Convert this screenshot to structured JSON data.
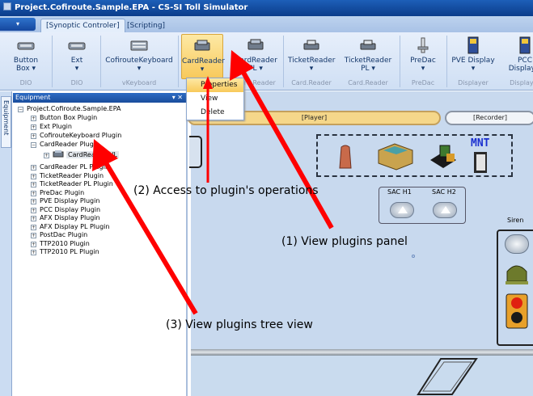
{
  "window": {
    "title": "Project.Cofiroute.Sample.EPA - CS-SI Toll Simulator"
  },
  "tabs": [
    {
      "label": "[Synoptic Controler]",
      "active": true
    },
    {
      "label": "[Scripting]",
      "active": false
    }
  ],
  "ribbon": {
    "buttons": [
      {
        "label": "Button Box",
        "group": "DIO",
        "icon": "device-icon"
      },
      {
        "label": "Ext",
        "group": "DIO",
        "icon": "device-icon"
      },
      {
        "label": "CofirouteKeyboard",
        "group": "vKeyboard",
        "icon": "keyboard-icon"
      },
      {
        "label": "CardReader",
        "group": "",
        "icon": "card-reader-icon",
        "selected": true
      },
      {
        "label": "CardReader PL",
        "group": "Card.Reader",
        "icon": "card-reader-icon"
      },
      {
        "label": "TicketReader",
        "group": "Card.Reader",
        "icon": "ticket-reader-icon"
      },
      {
        "label": "TicketReader PL",
        "group": "Card.Reader",
        "icon": "ticket-reader-icon"
      },
      {
        "label": "PreDac",
        "group": "PreDac",
        "icon": "predac-icon"
      },
      {
        "label": "PVE Display",
        "group": "Displayer",
        "icon": "display-icon"
      },
      {
        "label": "PCC Display",
        "group": "Displayer",
        "icon": "display-icon"
      }
    ],
    "dropdown": [
      "Properties",
      "View",
      "Delete"
    ]
  },
  "sidebar": {
    "tab_label": "Equipment"
  },
  "equipment_panel": {
    "title": "Equipment",
    "root": "Project.Cofiroute.Sample.EPA",
    "items": [
      "Button Box Plugin",
      "Ext Plugin",
      "CofirouteKeyboard Plugin",
      "CardReader Plugin",
      "CardReader_VL",
      "CardReader PL Plugin",
      "TicketReader Plugin",
      "TicketReader PL Plugin",
      "PreDac Plugin",
      "PVE Display Plugin",
      "PCC Display Plugin",
      "AFX Display Plugin",
      "AFX Display PL Plugin",
      "PostDac Plugin",
      "TTP2010 Plugin",
      "TTP2010 PL Plugin"
    ]
  },
  "canvas": {
    "player_label": "[Player]",
    "recorder_label": "[Recorder]",
    "mnt_label": "MNT",
    "sac1_label": "SAC H1",
    "sac2_label": "SAC H2",
    "siren_label": "Siren"
  },
  "annotations": {
    "a1": "(1) View plugins panel",
    "a2": "(2) Access to plugin's operations",
    "a3": "(3) View plugins tree view"
  },
  "colors": {
    "title_bar": "#0b3c8a",
    "selected_button": "#f8c95a",
    "arrow": "#ff0000"
  }
}
